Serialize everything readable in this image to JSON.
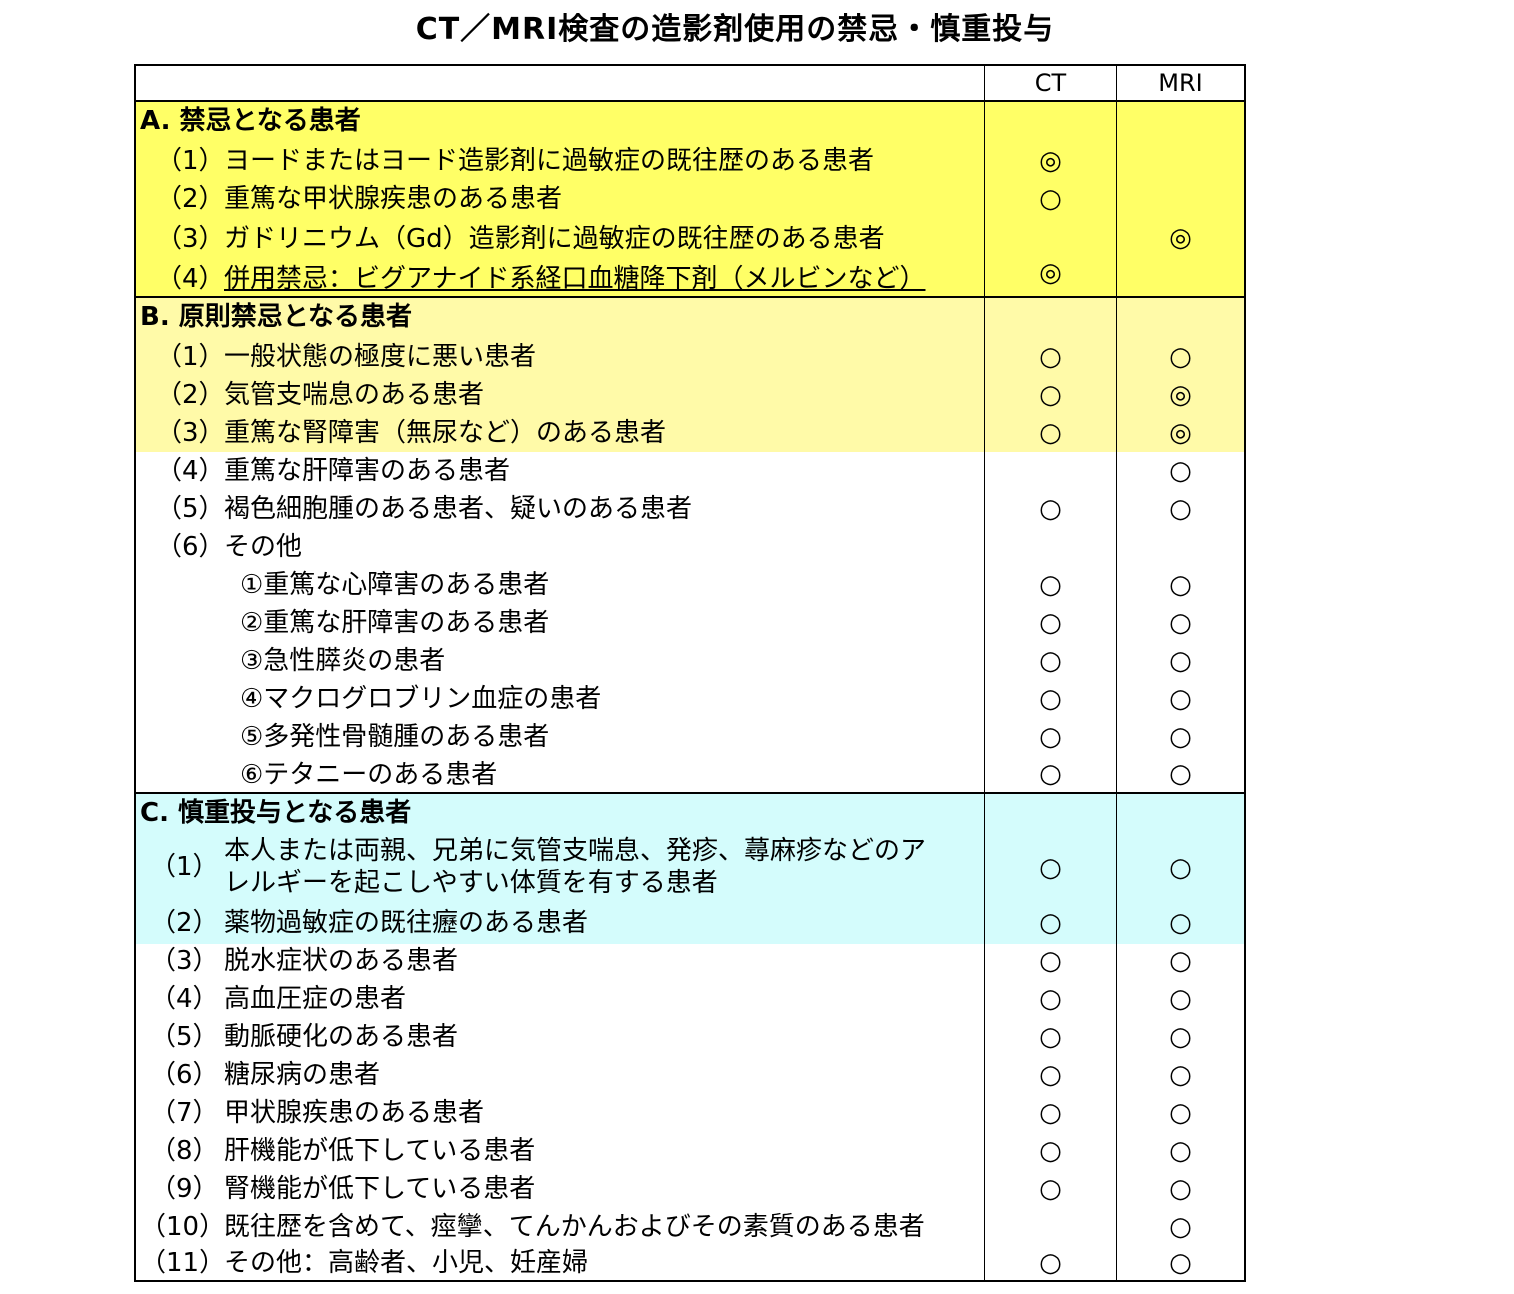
{
  "title": "CT／MRI検査の造影剤使用の禁忌・慎重投与",
  "header": {
    "ct": "CT",
    "mri": "MRI"
  },
  "sections": {
    "a": {
      "title": "A. 禁忌となる患者"
    },
    "b": {
      "title": "B. 原則禁忌となる患者"
    },
    "c": {
      "title": "C. 慎重投与となる患者"
    }
  },
  "rows": [
    {
      "num": "（1）",
      "text": "ヨードまたはヨード造影剤に過敏症の既往歴のある患者",
      "ct": "◎",
      "mri": ""
    },
    {
      "num": "（2）",
      "text": "重篤な甲状腺疾患のある患者",
      "ct": "○",
      "mri": ""
    },
    {
      "num": "（3）",
      "text": "ガドリニウム（Gd）造影剤に過敏症の既往歴のある患者",
      "ct": "",
      "mri": "◎"
    },
    {
      "num": "（4）",
      "text": "併用禁忌：ビグアナイド系経口血糖降下剤（メルビンなど）",
      "ct": "◎",
      "mri": ""
    },
    {
      "num": "（1）",
      "text": "一般状態の極度に悪い患者",
      "ct": "○",
      "mri": "○"
    },
    {
      "num": "（2）",
      "text": "気管支喘息のある患者",
      "ct": "○",
      "mri": "◎"
    },
    {
      "num": "（3）",
      "text": "重篤な腎障害（無尿など）のある患者",
      "ct": "○",
      "mri": "◎"
    },
    {
      "num": "（4）",
      "text": "重篤な肝障害のある患者",
      "ct": "",
      "mri": "○"
    },
    {
      "num": "（5）",
      "text": "褐色細胞腫のある患者、疑いのある患者",
      "ct": "○",
      "mri": "○"
    },
    {
      "num": "（6）",
      "text": "その他",
      "ct": "",
      "mri": ""
    },
    {
      "num": "",
      "text": "①重篤な心障害のある患者",
      "ct": "○",
      "mri": "○"
    },
    {
      "num": "",
      "text": "②重篤な肝障害のある患者",
      "ct": "○",
      "mri": "○"
    },
    {
      "num": "",
      "text": "③急性膵炎の患者",
      "ct": "○",
      "mri": "○"
    },
    {
      "num": "",
      "text": "④マクログロブリン血症の患者",
      "ct": "○",
      "mri": "○"
    },
    {
      "num": "",
      "text": "⑤多発性骨髄腫のある患者",
      "ct": "○",
      "mri": "○"
    },
    {
      "num": "",
      "text": "⑥テタニーのある患者",
      "ct": "○",
      "mri": "○"
    },
    {
      "num": "（1）",
      "text": "本人または両親、兄弟に気管支喘息、発疹、蕁麻疹などのア",
      "text2": "レルギーを起こしやすい体質を有する患者",
      "ct": "○",
      "mri": "○"
    },
    {
      "num": "（2）",
      "text": "薬物過敏症の既往癧のある患者",
      "ct": "○",
      "mri": "○"
    },
    {
      "num": "（3）",
      "text": "脱水症状のある患者",
      "ct": "○",
      "mri": "○"
    },
    {
      "num": "（4）",
      "text": "高血圧症の患者",
      "ct": "○",
      "mri": "○"
    },
    {
      "num": "（5）",
      "text": "動脈硬化のある患者",
      "ct": "○",
      "mri": "○"
    },
    {
      "num": "（6）",
      "text": "糖尿病の患者",
      "ct": "○",
      "mri": "○"
    },
    {
      "num": "（7）",
      "text": "甲状腺疾患のある患者",
      "ct": "○",
      "mri": "○"
    },
    {
      "num": "（8）",
      "text": "肝機能が低下している患者",
      "ct": "○",
      "mri": "○"
    },
    {
      "num": "（9）",
      "text": "腎機能が低下している患者",
      "ct": "○",
      "mri": "○"
    },
    {
      "num": "（10）",
      "text": "既往歴を含めて、痙攣、てんかんおよびその素質のある患者",
      "ct": "",
      "mri": "○"
    },
    {
      "num": "（11）",
      "text": "その他：高齢者、小児、妊産婦",
      "ct": "○",
      "mri": "○"
    }
  ]
}
